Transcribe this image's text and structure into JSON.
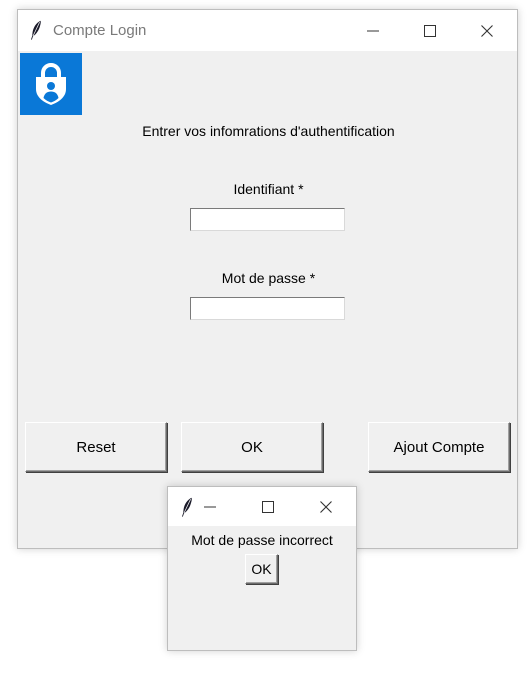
{
  "main_window": {
    "title": "Compte Login",
    "instruction": "Entrer vos infomrations d'authentification",
    "username_label": "Identifiant *",
    "username_value": "",
    "password_label": "Mot de passe *",
    "password_value": "",
    "buttons": {
      "reset": "Reset",
      "ok": "OK",
      "add_account": "Ajout Compte"
    },
    "logo_icon": "lock-person-icon",
    "logo_color": "#0a78d7"
  },
  "dialog": {
    "title": "",
    "message": "Mot de passe incorrect",
    "ok_label": "OK"
  }
}
